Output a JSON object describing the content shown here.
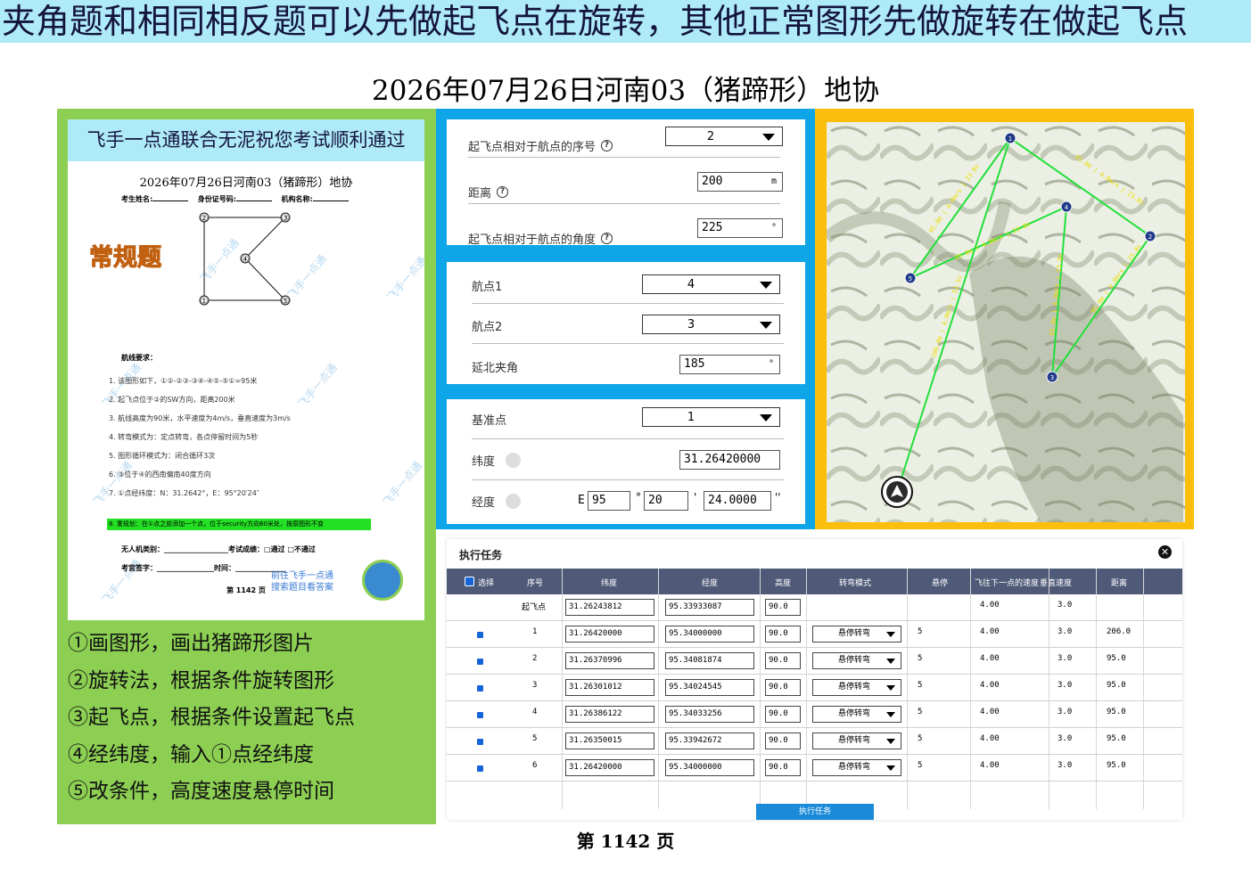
{
  "banner": "夹角题和相同相反题可以先做起飞点在旋转，其他正常图形先做旋转在做起飞点",
  "page_title": "2026年07月26日河南03（猪蹄形）地协",
  "doc": {
    "header": "飞手一点通联合无泥祝您考试顺利通过",
    "subtitle": "2026年07月26日河南03（猪蹄形）地协",
    "fields": [
      "考生姓名:",
      "身份证号码:",
      "机构名称:"
    ],
    "badge": "常规题",
    "watermark": "飞手一点通",
    "point_labels": [
      "①",
      "②",
      "③",
      "④",
      "⑤"
    ],
    "requirements_title": "航线要求：",
    "requirements": [
      "1.  该图形如下，①②-②③-③④-④⑤-⑤①=95米",
      "2.  起飞点位于②的SW方向，距离200米",
      "3.  航线高度为90米，水平速度为4m/s，垂直速度为3m/s",
      "4.  转弯模式为：定点转弯，各点停留时间为5秒",
      "5.  图形循环模式为：闭合循环3次",
      "6.  ③位于④的西南偏南40度方向",
      "7.  ①点经纬度：N：31.2642°，E：95°20′24″"
    ],
    "green_line": "8. 重规划：在①点之前添加一个点，位于security方向60米处，按原图形不变",
    "footer_rows": [
      "无人机类别：__________________考试成绩：□通过   □不通过",
      "考官签字：________________时间：______________"
    ],
    "promo": [
      "前往飞手一点通",
      "搜索题目看答案"
    ],
    "page": "第 1142 页"
  },
  "steps": [
    "①画图形，画出猪蹄形图片",
    "②旋转法，根据条件旋转图形",
    "③起飞点，根据条件设置起飞点",
    "④经纬度，输入①点经纬度",
    "⑤改条件，高度速度悬停时间"
  ],
  "takeoff": {
    "seq_label": "起飞点相对于航点的序号",
    "seq_value": "2",
    "dist_label": "距离",
    "dist_value": "200",
    "dist_unit": "m",
    "angle_label": "起飞点相对于航点的角度",
    "angle_value": "225",
    "angle_unit": "°"
  },
  "rotate": {
    "wp1_label": "航点1",
    "wp1_value": "4",
    "wp2_label": "航点2",
    "wp2_value": "3",
    "angle_label": "延北夹角",
    "angle_value": "185",
    "angle_unit": "°"
  },
  "coords": {
    "base_label": "基准点",
    "base_value": "1",
    "lat_label": "纬度",
    "lat_value": "31.26420000",
    "lon_label": "经度",
    "lon_prefix": "E",
    "lon_deg": "95",
    "lon_min": "20",
    "lon_sec": "24.0000",
    "deg_sym": "°",
    "min_sym": "'",
    "sec_sym": "''"
  },
  "map": {
    "waypoints": [
      "1",
      "2",
      "3",
      "4",
      "5"
    ],
    "segment_labels": [
      "95.0m | 4.0m/s | 23.8s",
      "95.0m | 4.0m/s | 23.8s",
      "95.0m | 4.0m/s | 23.8s",
      "95.0m | 4.0m/s | 23.8s",
      "95.0m | 4.0m/s | 23.8s",
      "206.0m | 4.0m/s | 51.5s"
    ]
  },
  "task": {
    "title": "执行任务",
    "close": "✕",
    "columns": [
      "选择",
      "序号",
      "纬度",
      "经度",
      "高度",
      "转弯模式",
      "悬停",
      "飞往下一点的速度",
      "垂直速度",
      "距离"
    ],
    "rows": [
      {
        "seq": "起飞点",
        "lat": "31.26243812",
        "lon": "95.33933087",
        "alt": "90.0",
        "mode": "",
        "hover": "",
        "speed": "4.00",
        "vspeed": "3.0",
        "dist": ""
      },
      {
        "seq": "1",
        "lat": "31.26420000",
        "lon": "95.34000000",
        "alt": "90.0",
        "mode": "悬停转弯",
        "hover": "5",
        "speed": "4.00",
        "vspeed": "3.0",
        "dist": "206.0"
      },
      {
        "seq": "2",
        "lat": "31.26370996",
        "lon": "95.34081874",
        "alt": "90.0",
        "mode": "悬停转弯",
        "hover": "5",
        "speed": "4.00",
        "vspeed": "3.0",
        "dist": "95.0"
      },
      {
        "seq": "3",
        "lat": "31.26301012",
        "lon": "95.34024545",
        "alt": "90.0",
        "mode": "悬停转弯",
        "hover": "5",
        "speed": "4.00",
        "vspeed": "3.0",
        "dist": "95.0"
      },
      {
        "seq": "4",
        "lat": "31.26386122",
        "lon": "95.34033256",
        "alt": "90.0",
        "mode": "悬停转弯",
        "hover": "5",
        "speed": "4.00",
        "vspeed": "3.0",
        "dist": "95.0"
      },
      {
        "seq": "5",
        "lat": "31.26350015",
        "lon": "95.33942672",
        "alt": "90.0",
        "mode": "悬停转弯",
        "hover": "5",
        "speed": "4.00",
        "vspeed": "3.0",
        "dist": "95.0"
      },
      {
        "seq": "6",
        "lat": "31.26420000",
        "lon": "95.34000000",
        "alt": "90.0",
        "mode": "悬停转弯",
        "hover": "5",
        "speed": "4.00",
        "vspeed": "3.0",
        "dist": "95.0"
      }
    ],
    "run_label": "执行任务"
  },
  "page_number": "第 1142 页"
}
